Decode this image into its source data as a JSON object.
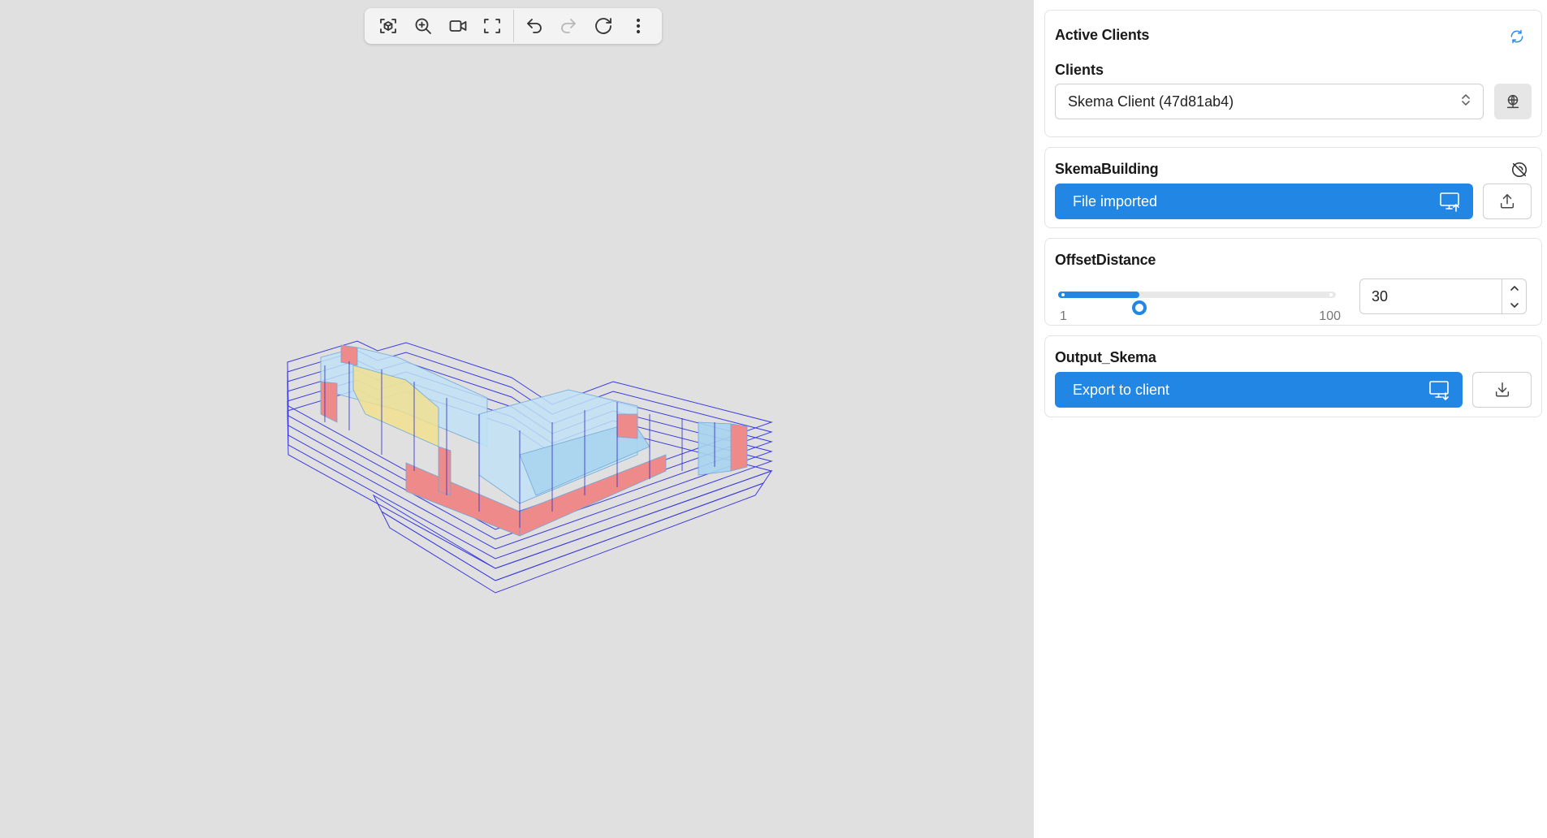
{
  "toolbar": {
    "buttons": [
      {
        "name": "fit-view-icon"
      },
      {
        "name": "zoom-in-icon"
      },
      {
        "name": "video-camera-icon"
      },
      {
        "name": "fullscreen-icon"
      },
      {
        "name": "undo-icon"
      },
      {
        "name": "redo-icon",
        "disabled": true
      },
      {
        "name": "reload-icon"
      },
      {
        "name": "more-vertical-icon"
      }
    ]
  },
  "active_clients": {
    "title": "Active Clients",
    "clients_label": "Clients",
    "selected_client": "Skema Client (47d81ab4)"
  },
  "skema_building": {
    "title": "SkemaBuilding",
    "button_label": "File imported"
  },
  "offset_distance": {
    "title": "OffsetDistance",
    "min": "1",
    "max": "100",
    "value": "30",
    "value_fraction": 0.293
  },
  "output_skema": {
    "title": "Output_Skema",
    "button_label": "Export to client"
  },
  "colors": {
    "accent": "#2186e4",
    "viewport_bg": "#e0e0e0",
    "panel_bg": "#ffffff",
    "wireframe": "#3a3ae0",
    "room_blue": "#a9d4f0",
    "room_yellow": "#f2e08a",
    "room_red": "#ee8a8a"
  }
}
